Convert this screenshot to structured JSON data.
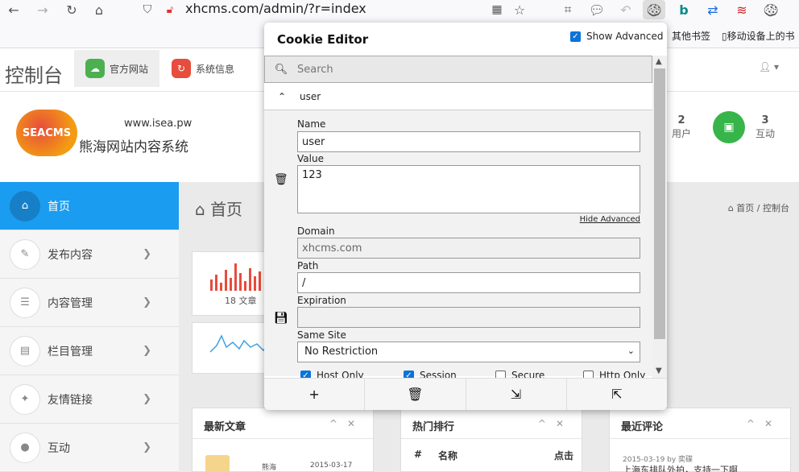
{
  "browser": {
    "url": "xhcms.com/admin/?r=index",
    "bookmarks": {
      "other": "其他书签",
      "mobile": "移动设备上的书"
    }
  },
  "cms": {
    "title": "控制台",
    "tabs": [
      {
        "label": "官方网站"
      },
      {
        "label": "系统信息"
      }
    ],
    "site_url": "www.isea.pw",
    "site_name": "熊海网站内容系统",
    "logo_text": "SEACMS",
    "stats": [
      {
        "value": "2",
        "label": "用户"
      },
      {
        "value": "3",
        "label": "互动"
      }
    ],
    "nav": [
      {
        "label": "首页"
      },
      {
        "label": "发布内容"
      },
      {
        "label": "内容管理"
      },
      {
        "label": "栏目管理"
      },
      {
        "label": "友情链接"
      },
      {
        "label": "互动"
      }
    ],
    "page_title": "首页",
    "breadcrumb": {
      "home": "首页",
      "current": "控制台"
    },
    "article_count_label": "18 文章",
    "panels": [
      {
        "title": "最新文章"
      },
      {
        "title": "热门排行"
      },
      {
        "title": "最近评论"
      }
    ],
    "hot_table": {
      "columns": [
        "#",
        "名称",
        "点击"
      ]
    },
    "recent_article": {
      "author": "熊海",
      "date": "2015-03-17"
    },
    "recent_comment": {
      "meta": "2015-03-19 by 奕碟",
      "text": "上海东排队外拍，支持一下啊"
    }
  },
  "cookie_editor": {
    "title": "Cookie Editor",
    "show_advanced_label": "Show Advanced",
    "search_placeholder": "Search",
    "cookie_name": "user",
    "fields": {
      "name_label": "Name",
      "name_value": "user",
      "value_label": "Value",
      "value_value": "123",
      "hide_advanced": "Hide Advanced",
      "domain_label": "Domain",
      "domain_value": "xhcms.com",
      "path_label": "Path",
      "path_value": "/",
      "expiration_label": "Expiration",
      "expiration_value": "",
      "samesite_label": "Same Site",
      "samesite_value": "No Restriction"
    },
    "flags": [
      {
        "label": "Host Only",
        "checked": true
      },
      {
        "label": "Session",
        "checked": true
      },
      {
        "label": "Secure",
        "checked": false
      },
      {
        "label": "Http Only",
        "checked": false
      }
    ]
  }
}
